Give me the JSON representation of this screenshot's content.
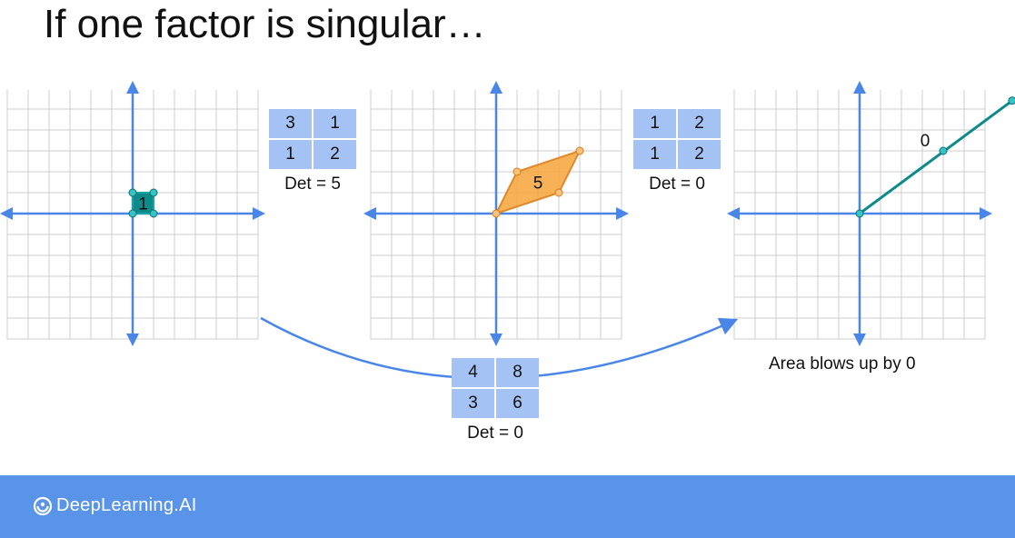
{
  "slide": {
    "title": "If one factor is singular…"
  },
  "colors": {
    "axis": "#4a86e8",
    "grid": "#cccccc",
    "teal": "#0e8a8a",
    "orange": "#f6a43a",
    "matrix_fill": "#a4c2f4",
    "footer": "#5a94e8"
  },
  "panels": [
    {
      "id": "left",
      "shape_label": "1"
    },
    {
      "id": "middle",
      "shape_label": "5"
    },
    {
      "id": "right",
      "line_label": "0",
      "caption": "Area blows up by 0"
    }
  ],
  "matrices": {
    "first": {
      "cells": [
        "3",
        "1",
        "1",
        "2"
      ],
      "det": "Det = 5"
    },
    "second": {
      "cells": [
        "1",
        "2",
        "1",
        "2"
      ],
      "det": "Det = 0"
    },
    "product": {
      "cells": [
        "4",
        "8",
        "3",
        "6"
      ],
      "det": "Det = 0"
    }
  },
  "footer": {
    "brand": "DeepLearning.AI",
    "logo_icon": "deeplearning-logo-icon"
  }
}
